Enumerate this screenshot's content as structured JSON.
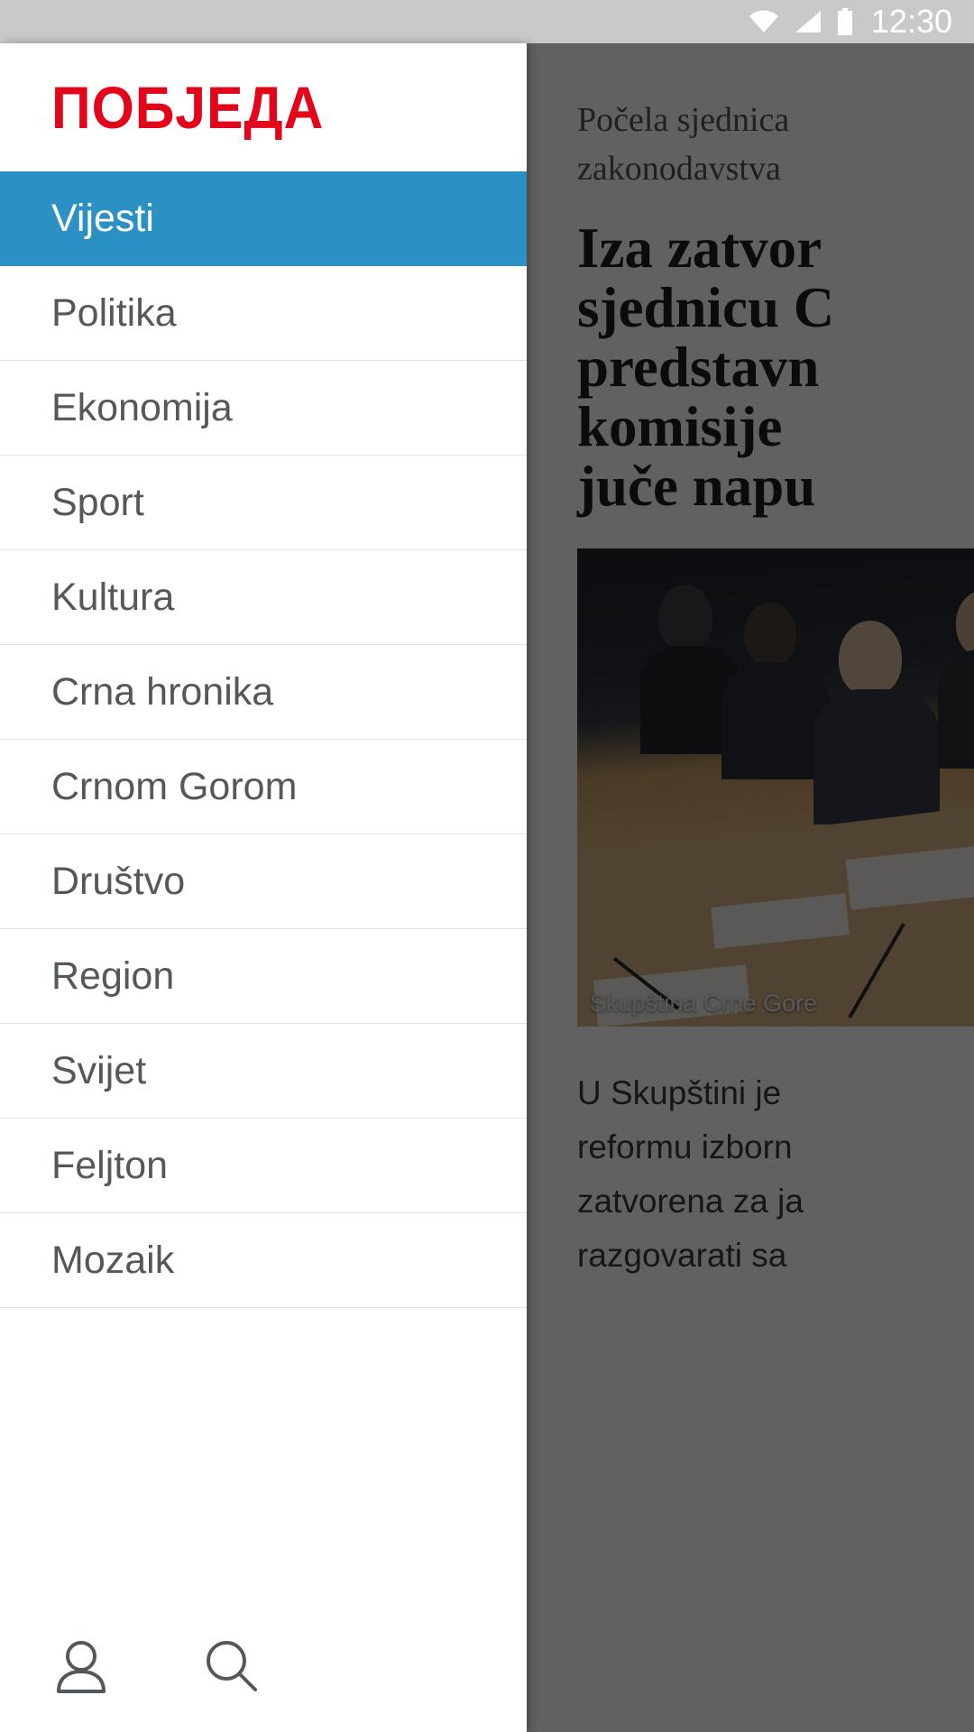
{
  "statusbar": {
    "time": "12:30",
    "icons": [
      "wifi-icon",
      "cell-signal-icon",
      "battery-icon"
    ]
  },
  "drawer": {
    "logo": "ПОБЈЕДА",
    "logo_color": "#e3061a",
    "active_color": "#2b90c4",
    "items": [
      {
        "label": "Vijesti",
        "active": true
      },
      {
        "label": "Politika",
        "active": false
      },
      {
        "label": "Ekonomija",
        "active": false
      },
      {
        "label": "Sport",
        "active": false
      },
      {
        "label": "Kultura",
        "active": false
      },
      {
        "label": "Crna hronika",
        "active": false
      },
      {
        "label": "Crnom Gorom",
        "active": false
      },
      {
        "label": "Društvo",
        "active": false
      },
      {
        "label": "Region",
        "active": false
      },
      {
        "label": "Svijet",
        "active": false
      },
      {
        "label": "Feljton",
        "active": false
      },
      {
        "label": "Mozaik",
        "active": false
      }
    ],
    "bottom_bar": {
      "profile_icon": "person-icon",
      "search_icon": "search-icon"
    }
  },
  "article": {
    "kicker_lines": [
      "Počela sjednica",
      "zakonodavstva"
    ],
    "headline_lines": [
      "Iza zatvor",
      "sjednicu C",
      "predstavn",
      "komisije",
      "juče napu"
    ],
    "photo_caption": "Skupština Crne Gore",
    "body_lines": [
      "U Skupštini je",
      "reformu izborn",
      "zatvorena za ja",
      "razgovarati sa"
    ]
  }
}
